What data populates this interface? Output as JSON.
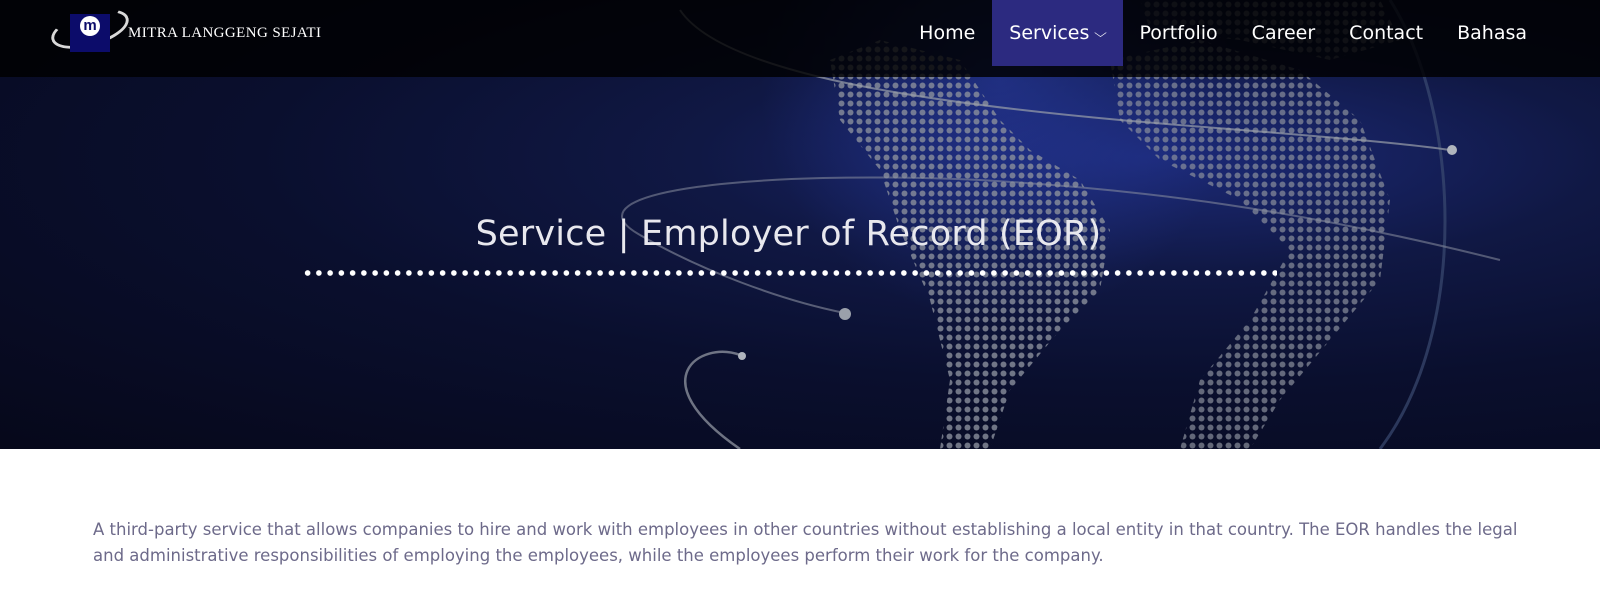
{
  "brand": {
    "logo_letter": "m",
    "name": "MITRA LANGGENG SEJATI"
  },
  "nav": {
    "home": "Home",
    "services": "Services",
    "portfolio": "Portfolio",
    "career": "Career",
    "contact": "Contact",
    "bahasa": "Bahasa",
    "active_color": "#2c2a80"
  },
  "hero": {
    "title": "Service | Employer of Record (EOR)"
  },
  "content": {
    "intro": "A third-party service that allows companies to hire and work with employees in other countries without establishing a local entity in that country. The EOR handles the legal and administrative responsibilities of employing the employees, while the employees perform their work for the company."
  },
  "icons": {
    "services_dropdown": "chevron-down-icon"
  }
}
